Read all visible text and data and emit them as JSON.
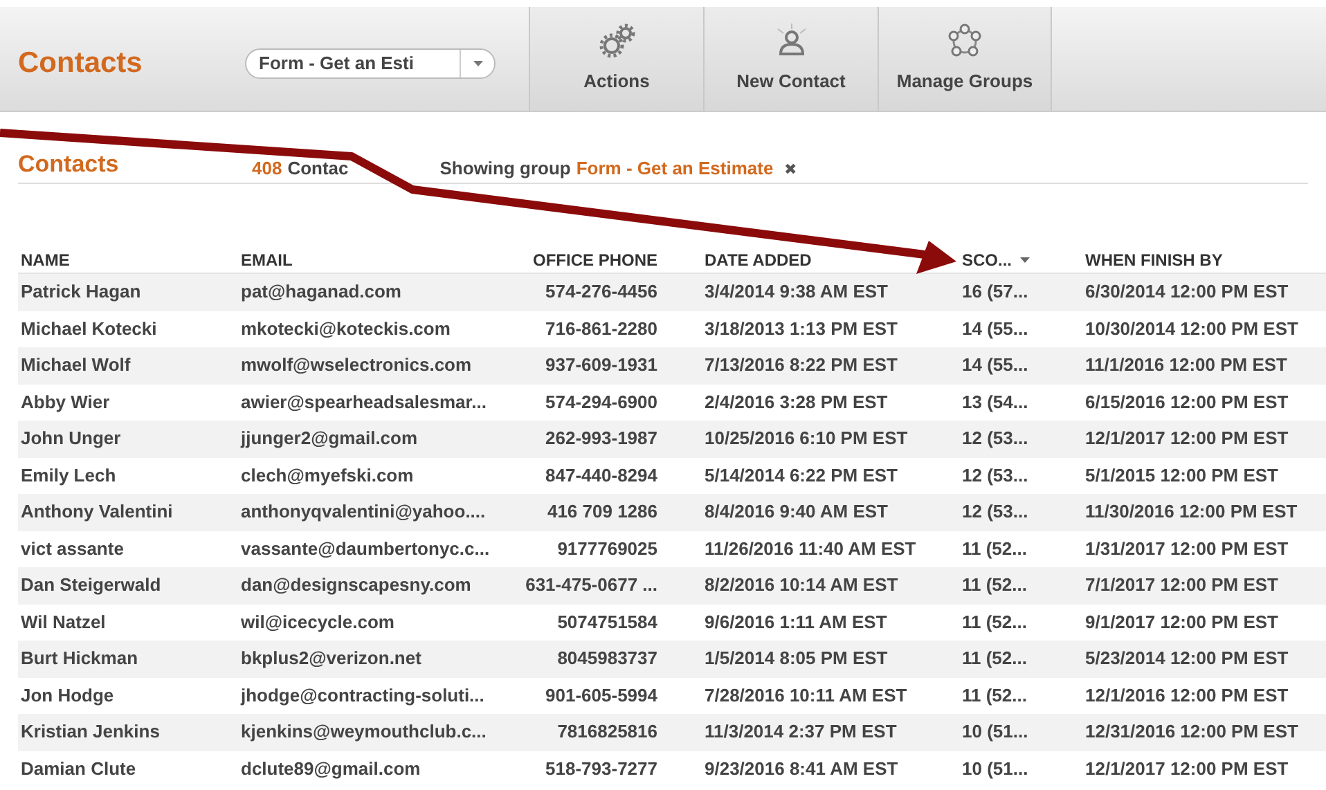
{
  "header": {
    "title": "Contacts",
    "group_select": {
      "value": "Form - Get an Esti"
    },
    "buttons": [
      {
        "label": "Actions"
      },
      {
        "label": "New Contact"
      },
      {
        "label": "Manage Groups"
      }
    ]
  },
  "subheader": {
    "title": "Contacts",
    "count": "408",
    "count_label": "Contac",
    "showing": "Showing group",
    "group": "Form - Get an Estimate",
    "clear": "✖"
  },
  "table": {
    "columns": [
      {
        "label": "NAME",
        "sorted": false
      },
      {
        "label": "EMAIL",
        "sorted": false
      },
      {
        "label": "OFFICE PHONE",
        "sorted": false
      },
      {
        "label": "DATE ADDED",
        "sorted": false
      },
      {
        "label": "SCO...",
        "sorted": true
      },
      {
        "label": "WHEN FINISH BY",
        "sorted": false
      }
    ],
    "rows": [
      [
        "Patrick Hagan",
        "pat@haganad.com",
        "574-276-4456",
        "3/4/2014 9:38 AM EST",
        "16 (57...",
        "6/30/2014 12:00 PM EST"
      ],
      [
        "Michael Kotecki",
        "mkotecki@koteckis.com",
        "716-861-2280",
        "3/18/2013 1:13 PM EST",
        "14 (55...",
        "10/30/2014 12:00 PM EST"
      ],
      [
        "Michael Wolf",
        "mwolf@wselectronics.com",
        "937-609-1931",
        "7/13/2016 8:22 PM EST",
        "14 (55...",
        "11/1/2016 12:00 PM EST"
      ],
      [
        "Abby Wier",
        "awier@spearheadsalesmar...",
        "574-294-6900",
        "2/4/2016 3:28 PM EST",
        "13 (54...",
        "6/15/2016 12:00 PM EST"
      ],
      [
        "John Unger",
        "jjunger2@gmail.com",
        "262-993-1987",
        "10/25/2016 6:10 PM EST",
        "12 (53...",
        "12/1/2017 12:00 PM EST"
      ],
      [
        "Emily Lech",
        "clech@myefski.com",
        "847-440-8294",
        "5/14/2014 6:22 PM EST",
        "12 (53...",
        "5/1/2015 12:00 PM EST"
      ],
      [
        "Anthony Valentini",
        "anthonyqvalentini@yahoo....",
        "416 709 1286",
        "8/4/2016 9:40 AM EST",
        "12 (53...",
        "11/30/2016 12:00 PM EST"
      ],
      [
        "vict assante",
        "vassante@daumbertonyc.c...",
        "9177769025",
        "11/26/2016 11:40 AM EST",
        "11 (52...",
        "1/31/2017 12:00 PM EST"
      ],
      [
        "Dan Steigerwald",
        "dan@designscapesny.com",
        "631-475-0677 ...",
        "8/2/2016 10:14 AM EST",
        "11 (52...",
        "7/1/2017 12:00 PM EST"
      ],
      [
        "Wil Natzel",
        "wil@icecycle.com",
        "5074751584",
        "9/6/2016 1:11 AM EST",
        "11 (52...",
        "9/1/2017 12:00 PM EST"
      ],
      [
        "Burt Hickman",
        "bkplus2@verizon.net",
        "8045983737",
        "1/5/2014 8:05 PM EST",
        "11 (52...",
        "5/23/2014 12:00 PM EST"
      ],
      [
        "Jon Hodge",
        "jhodge@contracting-soluti...",
        "901-605-5994",
        "7/28/2016 10:11 AM EST",
        "11 (52...",
        "12/1/2016 12:00 PM EST"
      ],
      [
        "Kristian Jenkins",
        "kjenkins@weymouthclub.c...",
        "7816825816",
        "11/3/2014 2:37 PM EST",
        "10 (51...",
        "12/31/2016 12:00 PM EST"
      ],
      [
        "Damian Clute",
        "dclute89@gmail.com",
        "518-793-7277",
        "9/23/2016 8:41 AM EST",
        "10 (51...",
        "12/1/2017 12:00 PM EST"
      ]
    ]
  }
}
